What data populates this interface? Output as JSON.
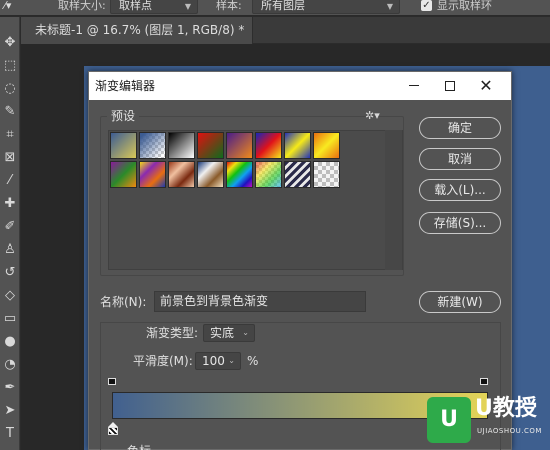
{
  "options_bar": {
    "sample_size_label": "取样大小:",
    "sample_size_value": "取样点",
    "sample_label": "样本:",
    "sample_value": "所有图层",
    "show_ring_label": "显示取样环"
  },
  "document": {
    "tab_title": "未标题-1 @ 16.7% (图层 1, RGB/8) *"
  },
  "dialog": {
    "title": "渐变编辑器",
    "presets_label": "预设",
    "buttons": {
      "ok": "确定",
      "cancel": "取消",
      "load": "载入(L)...",
      "save": "存储(S)...",
      "new": "新建(W)"
    },
    "name_label": "名称(N):",
    "name_value": "前景色到背景色渐变",
    "gradient_type_label": "渐变类型:",
    "gradient_type_value": "实底",
    "smoothness_label": "平滑度(M):",
    "smoothness_value": "100",
    "smoothness_unit": "%",
    "stops_section_label": "色标",
    "gradient_colors": [
      "#41608f",
      "#e4d457"
    ]
  },
  "presets": [
    {
      "name": "foreground-to-background",
      "css": "linear-gradient(135deg,#3c5c93,#d9c857)"
    },
    {
      "name": "foreground-to-transparent",
      "css": "linear-gradient(135deg,#3c5c93 10%,rgba(60,92,147,0) 90%), repeating-conic-gradient(#ccc 0 25%,#fff 0 50%) 0 0/6px 6px"
    },
    {
      "name": "black-white",
      "css": "linear-gradient(135deg,#000,#fff)"
    },
    {
      "name": "red-green",
      "css": "linear-gradient(135deg,#e01010,#0e6b1c)"
    },
    {
      "name": "violet-orange",
      "css": "linear-gradient(135deg,#4a1d8a,#f08a1a)"
    },
    {
      "name": "blue-red-yellow",
      "css": "linear-gradient(135deg,#1626b8,#e0121a,#f5e81a)"
    },
    {
      "name": "blue-yellow-blue",
      "css": "linear-gradient(135deg,#2232b8,#f6ea18,#2232b8)"
    },
    {
      "name": "orange-yellow-orange",
      "css": "linear-gradient(135deg,#e86e10,#f8ea20,#e86e10)"
    },
    {
      "name": "violet-green-orange",
      "css": "linear-gradient(135deg,#8a1a9a,#2a8a2a,#f08a10)"
    },
    {
      "name": "yellow-violet-orange-blue",
      "css": "linear-gradient(135deg,#f5d818,#8a2ab0,#e86e10,#1a3ab0)"
    },
    {
      "name": "copper",
      "css": "linear-gradient(135deg,#9a3a1a,#f0c0a0,#7a2a10,#f0c8a8)"
    },
    {
      "name": "chrome",
      "css": "linear-gradient(135deg,#1a3a7a,#f0f0f0,#8a5a2a,#f0e0c0)"
    },
    {
      "name": "spectrum",
      "css": "linear-gradient(135deg,#e01010,#f0e010,#10c010,#10a0f0,#2010c0,#c010c0)"
    },
    {
      "name": "transparent-rainbow",
      "css": "linear-gradient(135deg,rgba(224,16,16,.6),rgba(240,224,16,.6),rgba(16,192,16,.6),rgba(16,160,240,.6)), repeating-conic-gradient(#ccc 0 25%,#fff 0 50%) 0 0/6px 6px"
    },
    {
      "name": "transparent-stripes",
      "css": "repeating-linear-gradient(135deg,#2a2a4a 0 3px,#e8e8e8 3px 6px)"
    },
    {
      "name": "transparent-checker",
      "css": "repeating-conic-gradient(#bdbdbd 0 25%,#f4f4f4 0 50%) 0 0/8px 8px"
    }
  ],
  "tools": [
    "move-icon",
    "marquee-icon",
    "lasso-icon",
    "magic-wand-icon",
    "crop-icon",
    "frame-icon",
    "eyedropper-icon",
    "healing-icon",
    "brush-icon",
    "stamp-icon",
    "history-brush-icon",
    "eraser-icon",
    "gradient-icon",
    "blur-icon",
    "dodge-icon",
    "pen-icon",
    "type-icon"
  ],
  "watermark": {
    "logo_text": "U",
    "brand": "U教授",
    "url": "UJIAOSHOU.COM"
  }
}
